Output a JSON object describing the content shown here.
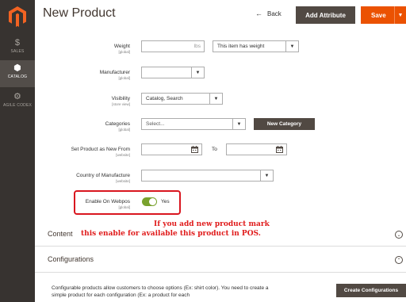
{
  "sidebar": {
    "items": [
      {
        "label": "SALES",
        "icon": "dollar-icon",
        "glyph": "$"
      },
      {
        "label": "CATALOG",
        "icon": "cube-icon",
        "glyph": "⬢"
      },
      {
        "label": "AGILE CODEX",
        "icon": "gear-icon",
        "glyph": "⚙"
      }
    ]
  },
  "header": {
    "title": "New Product",
    "back_label": "Back",
    "add_attribute_label": "Add Attribute",
    "save_label": "Save"
  },
  "form": {
    "weight": {
      "label": "Weight",
      "scope": "[global]",
      "unit": "lbs",
      "type_value": "This item has weight"
    },
    "manufacturer": {
      "label": "Manufacturer",
      "scope": "[global]",
      "value": ""
    },
    "visibility": {
      "label": "Visibility",
      "scope": "[store view]",
      "value": "Catalog, Search"
    },
    "categories": {
      "label": "Categories",
      "scope": "[global]",
      "placeholder": "Select...",
      "new_category_label": "New Category"
    },
    "new_from": {
      "label": "Set Product as New From",
      "scope": "[website]",
      "to_label": "To"
    },
    "country": {
      "label": "Country of Manufacture",
      "scope": "[website]",
      "value": ""
    },
    "webpos": {
      "label": "Enable On Webpos",
      "scope": "[global]",
      "value_label": "Yes",
      "enabled": true
    }
  },
  "annotation": {
    "line1": "If you add new product mark",
    "line2": "this enable for available this product in POS."
  },
  "sections": {
    "content_title": "Content",
    "configurations_title": "Configurations",
    "config_text": "Configurable products allow customers to choose options (Ex: shirt color). You need to create a simple product for each configuration (Ex: a product for each",
    "create_config_label": "Create Configurations"
  },
  "colors": {
    "accent": "#eb5202",
    "sidebar": "#373330",
    "annotation": "#d9161f",
    "toggle_on": "#79a22e"
  }
}
